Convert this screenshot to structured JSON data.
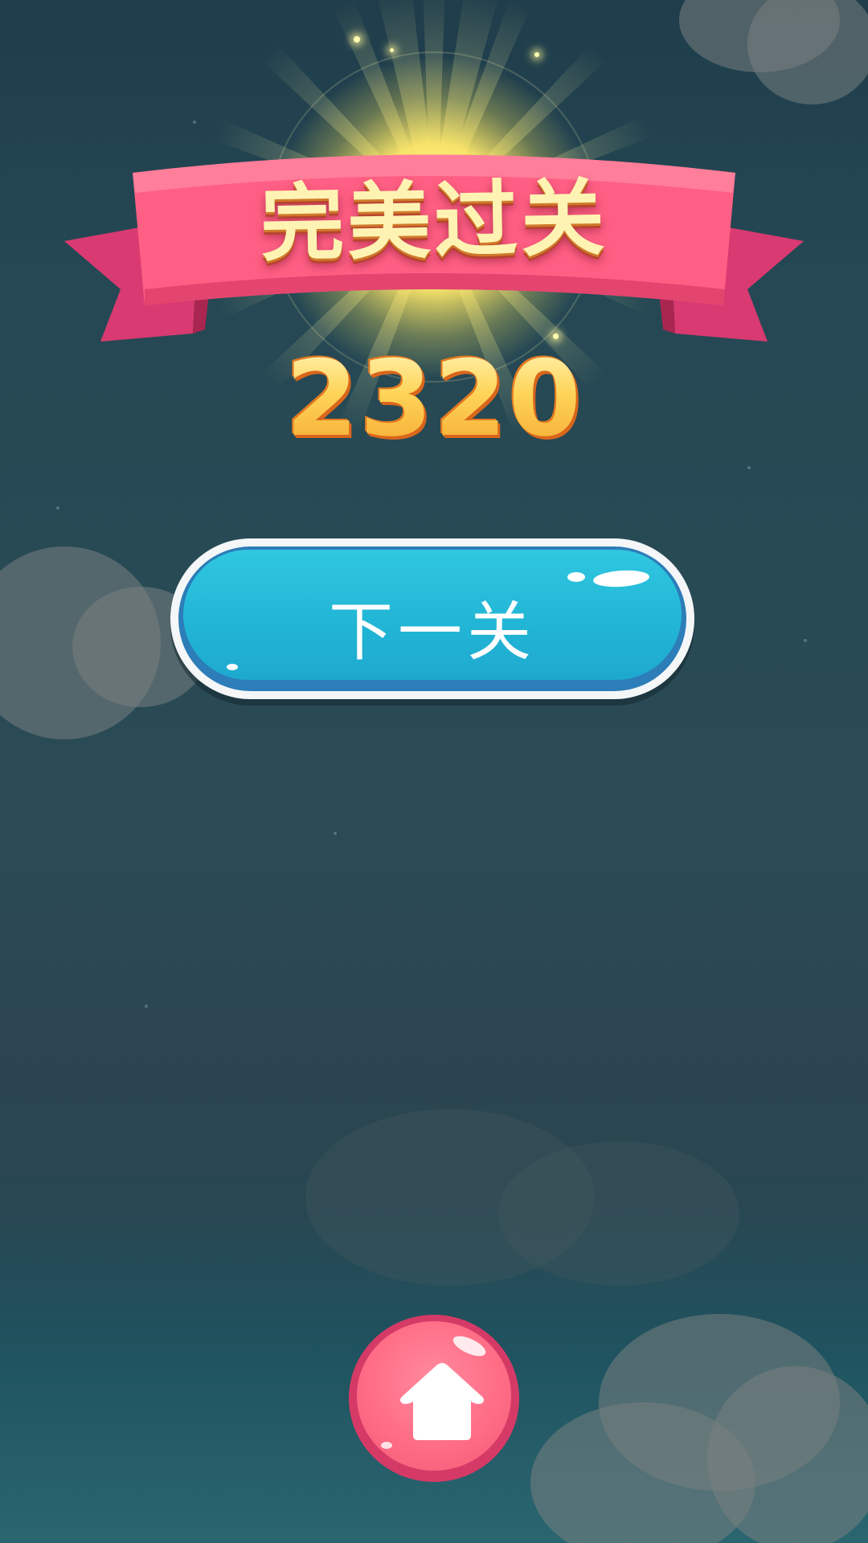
{
  "title": "完美过关",
  "score": "2320",
  "next_button": {
    "label": "下一关"
  },
  "home_button": {
    "icon": "home-icon"
  },
  "colors": {
    "ribbon": "#ff5f84",
    "next_button": "#22b6d6",
    "home_button": "#ff6d86",
    "score": "#ffd45e"
  }
}
